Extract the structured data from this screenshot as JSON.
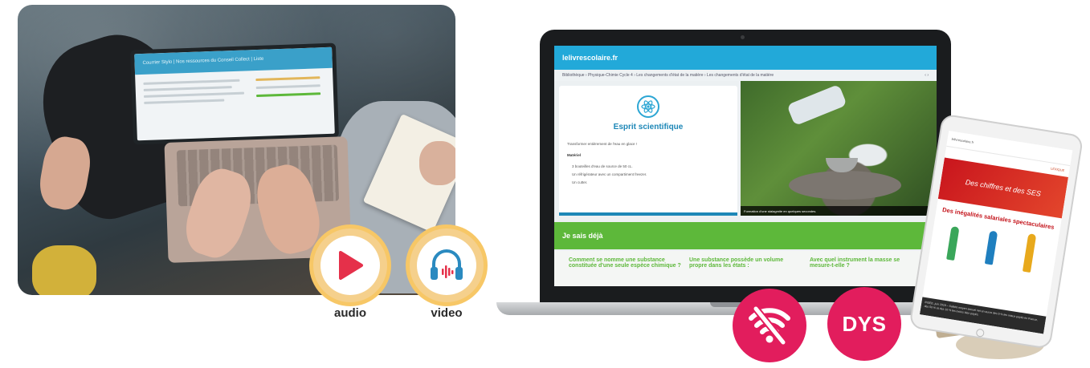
{
  "left_photo": {
    "laptop_screen_header": "Courrier Stylo | Nos ressources du Conseil Collect | Liste"
  },
  "media": {
    "audio_label": "audio",
    "video_label": "video"
  },
  "laptop_app": {
    "logo": "lelivrescolaire.fr",
    "breadcrumb": "Bibliothèque › Physique-Chimie Cycle 4 › Les changements d'état de la matière › Les changements d'état de la matière",
    "card_title": "Esprit scientifique",
    "card_intro": "Transformer entièrement de l'eau en glace !",
    "materiel_heading": "Matériel",
    "materiel_items": [
      "3 bouteilles d'eau de source de 50 cL.",
      "Un réfrigérateur avec un compartiment freezer.",
      "Un cutter."
    ],
    "photo_caption": "Formation d'une stalagmite en quelques secondes.",
    "section_title": "Je sais déjà",
    "questions": [
      "Comment se nomme une substance constituée d'une seule espèce chimique ?",
      "Une substance possède un volume propre dans les états :",
      "Avec quel instrument la masse se mesure-t-elle ?"
    ]
  },
  "tablet_app": {
    "logo": "lelivrescolaire.fr",
    "toolbar": "LEXIQUE",
    "banner": "Des chiffres et des SES",
    "title": "Des inégalités salariales spectaculaires",
    "footer": "INSEE, juin 2018 – Salaire moyen annuel net en euros des 5 % les mieux payés en France, des 50 % et des 10 % les moins bien payés."
  },
  "badges": {
    "offline_icon": "wifi-off-icon",
    "dys_label": "DYS"
  },
  "colors": {
    "accent_orange": "#f7c766",
    "accent_pink": "#e21d5d",
    "brand_blue": "#22a9d9",
    "green": "#5db83a",
    "tablet_red": "#c9151d"
  }
}
